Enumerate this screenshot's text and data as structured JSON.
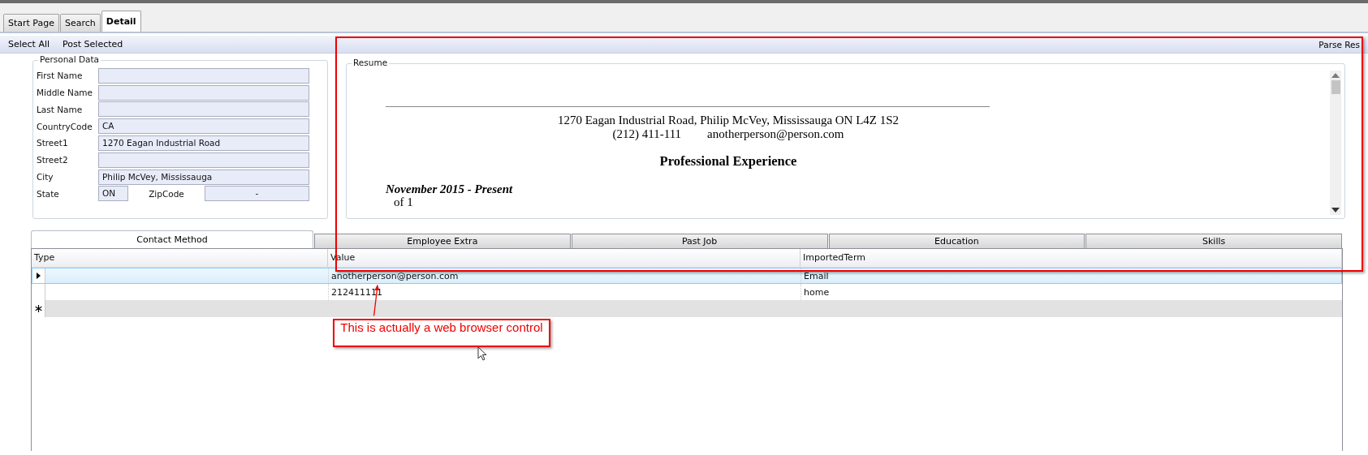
{
  "tabs": [
    {
      "label": "Start Page",
      "selected": false
    },
    {
      "label": "Search",
      "selected": false
    },
    {
      "label": "Detail",
      "selected": true
    }
  ],
  "toolbar": {
    "left_items": [
      "Select All",
      "Post Selected"
    ],
    "right_item": "Parse Res"
  },
  "personal_data": {
    "title": "Personal Data",
    "fields": [
      {
        "label": "First Name"
      },
      {
        "label": "Middle Name"
      },
      {
        "label": "Last Name"
      },
      {
        "label": "CountryCode",
        "value": "CA"
      },
      {
        "label": "Street1",
        "value": "1270 Eagan Industrial Road"
      },
      {
        "label": "Street2"
      },
      {
        "label": "City",
        "value": "Philip McVey, Mississauga"
      }
    ],
    "state": {
      "label": "State",
      "value": "ON"
    },
    "zip": {
      "label": "ZipCode",
      "value": "-"
    }
  },
  "resume": {
    "title": "Resume",
    "address": "1270 Eagan Industrial Road, Philip McVey, Mississauga ON L4Z 1S2",
    "phone": "(212) 411-111",
    "email": "anotherperson@person.com",
    "heading": "Professional Experience",
    "period": "November 2015 - Present",
    "page_note": "of 1"
  },
  "detail_tabs": [
    {
      "label": "Contact Method",
      "selected": true
    },
    {
      "label": "Employee Extra",
      "selected": false
    },
    {
      "label": "Past Job",
      "selected": false
    },
    {
      "label": "Education",
      "selected": false
    },
    {
      "label": "Skills",
      "selected": false
    }
  ],
  "grid": {
    "columns": [
      "Type",
      "Value",
      "ImportedTerm"
    ],
    "rows": [
      {
        "value": "anotherperson@person.com",
        "term": "Email",
        "selected": true
      },
      {
        "value": "212411111",
        "term": "home",
        "selected": false
      }
    ]
  },
  "annotation": {
    "text": "This is actually a web browser control"
  }
}
